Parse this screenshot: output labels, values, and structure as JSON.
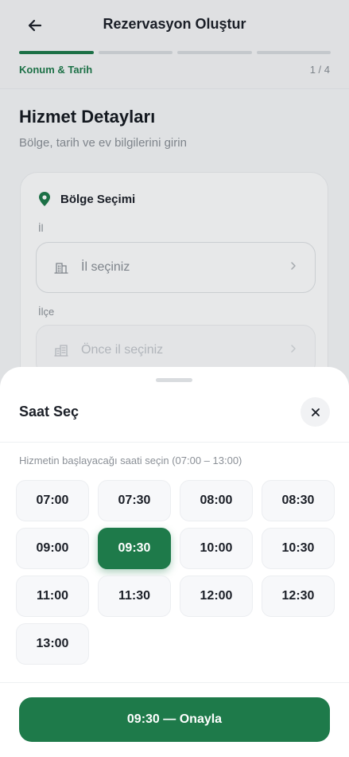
{
  "header": {
    "title": "Rezervasyon Oluştur",
    "back_icon": "arrow-left-icon",
    "step_label": "Konum & Tarih",
    "step_count": "1 / 4",
    "progress": {
      "total_steps": 4,
      "current_step": 1
    },
    "accent_color": "#1e7a4a"
  },
  "page": {
    "heading": "Hizmet Detayları",
    "subheading": "Bölge, tarih ve ev bilgilerini girin"
  },
  "region_card": {
    "title": "Bölge Seçimi",
    "title_icon": "location-pin-icon",
    "province": {
      "label": "İl",
      "placeholder": "İl seçiniz",
      "icon": "building-icon"
    },
    "district": {
      "label": "İlçe",
      "placeholder": "Önce il seçiniz",
      "icon": "city-icon"
    }
  },
  "time_sheet": {
    "title": "Saat Seç",
    "close_icon": "close-icon",
    "hint": "Hizmetin başlayacağı saati seçin (07:00 – 13:00)",
    "slots": [
      "07:00",
      "07:30",
      "08:00",
      "08:30",
      "09:00",
      "09:30",
      "10:00",
      "10:30",
      "11:00",
      "11:30",
      "12:00",
      "12:30",
      "13:00"
    ],
    "selected": "09:30",
    "confirm_label": "09:30 — Onayla"
  }
}
